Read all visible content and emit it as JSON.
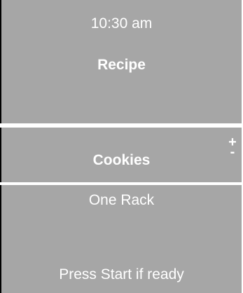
{
  "status": {
    "time": "10:30 am"
  },
  "header": {
    "title": "Recipe"
  },
  "selection": {
    "recipe": "Cookies",
    "increase_symbol": "+",
    "decrease_symbol": "-"
  },
  "details": {
    "rack": "One Rack",
    "prompt": "Press Start if ready"
  },
  "colors": {
    "panel": "#a6a6a6",
    "text": "#ffffff",
    "border": "#000000"
  }
}
